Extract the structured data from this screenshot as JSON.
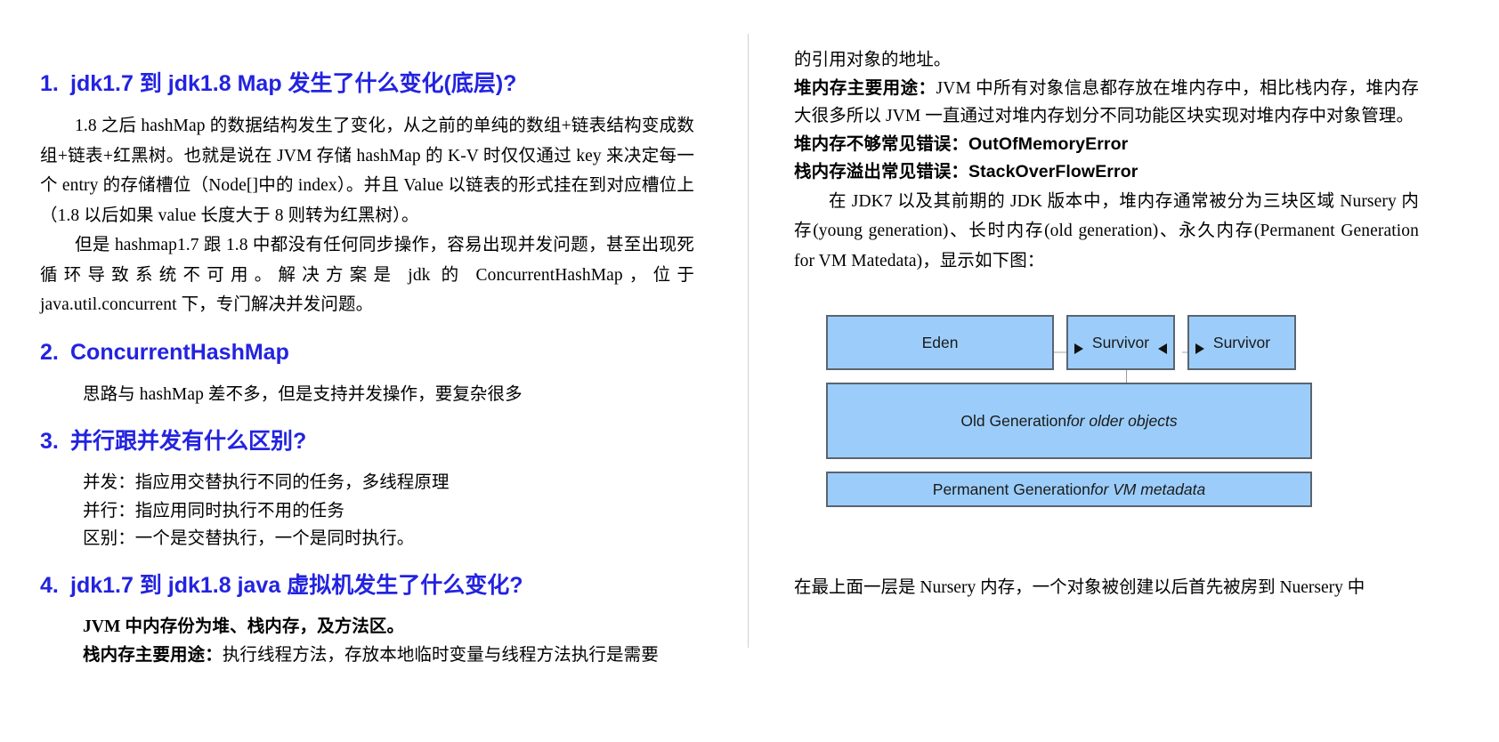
{
  "document": {
    "type": "technical-interview-notes",
    "language": "zh-CN",
    "heading_color": "#2323e0",
    "diagram_fill_color": "#9ccdfa",
    "diagram_border_color": "#5a6470"
  },
  "left_column": {
    "sections": [
      {
        "number": "1.",
        "heading": "jdk1.7 到 jdk1.8 Map 发生了什么变化(底层)?",
        "paragraphs": [
          "1.8 之后 hashMap 的数据结构发生了变化，从之前的单纯的数组+链表结构变成数组+链表+红黑树。也就是说在 JVM 存储 hashMap 的 K-V 时仅仅通过 key 来决定每一个 entry 的存储槽位（Node[]中的 index）。并且 Value 以链表的形式挂在到对应槽位上（1.8 以后如果 value 长度大于 8 则转为红黑树）。",
          "但是 hashmap1.7 跟 1.8 中都没有任何同步操作，容易出现并发问题，甚至出现死循环导致系统不可用。解决方案是 jdk 的 ConcurrentHashMap，位于 java.util.concurrent 下，专门解决并发问题。"
        ]
      },
      {
        "number": "2.",
        "heading": "ConcurrentHashMap",
        "paragraphs": [
          "思路与 hashMap 差不多，但是支持并发操作，要复杂很多"
        ]
      },
      {
        "number": "3.",
        "heading": "并行跟并发有什么区别?",
        "lines": [
          "并发：指应用交替执行不同的任务，多线程原理",
          "并行：指应用同时执行不用的任务",
          "区别：一个是交替执行，一个是同时执行。"
        ]
      },
      {
        "number": "4.",
        "heading": "jdk1.7 到 jdk1.8 java 虚拟机发生了什么变化?",
        "bold_lines": [
          "JVM 中内存份为堆、栈内存，及方法区。"
        ],
        "mixed_line": {
          "bold_prefix": "栈内存主要用途：",
          "rest": "执行线程方法，存放本地临时变量与线程方法执行是需要"
        }
      }
    ]
  },
  "right_column": {
    "continued_line": "的引用对象的地址。",
    "heap_use": {
      "bold_prefix": "堆内存主要用途：",
      "rest": "JVM 中所有对象信息都存放在堆内存中，相比栈内存，堆内存大很多所以 JVM 一直通过对堆内存划分不同功能区块实现对堆内存中对象管理。"
    },
    "errors": [
      {
        "label": "堆内存不够常见错误：",
        "value": "OutOfMemoryError"
      },
      {
        "label": "栈内存溢出常见错误：",
        "value": "StackOverFlowError"
      }
    ],
    "jdk7_paragraph": "在 JDK7 以及其前期的 JDK 版本中，堆内存通常被分为三块区域 Nursery 内存(young generation)、长时内存(old generation)、永久内存(Permanent Generation for VM Matedata)，显示如下图：",
    "diagram": {
      "eden": "Eden",
      "survivor_1": "Survivor",
      "survivor_2": "Survivor",
      "old_generation": {
        "main": "Old Generation ",
        "italic": "for older objects"
      },
      "permanent_generation": {
        "main": "Permanent Generation ",
        "italic": "for VM metadata"
      }
    },
    "tail_note": "在最上面一层是 Nursery 内存，一个对象被创建以后首先被房到 Nuersery 中"
  }
}
